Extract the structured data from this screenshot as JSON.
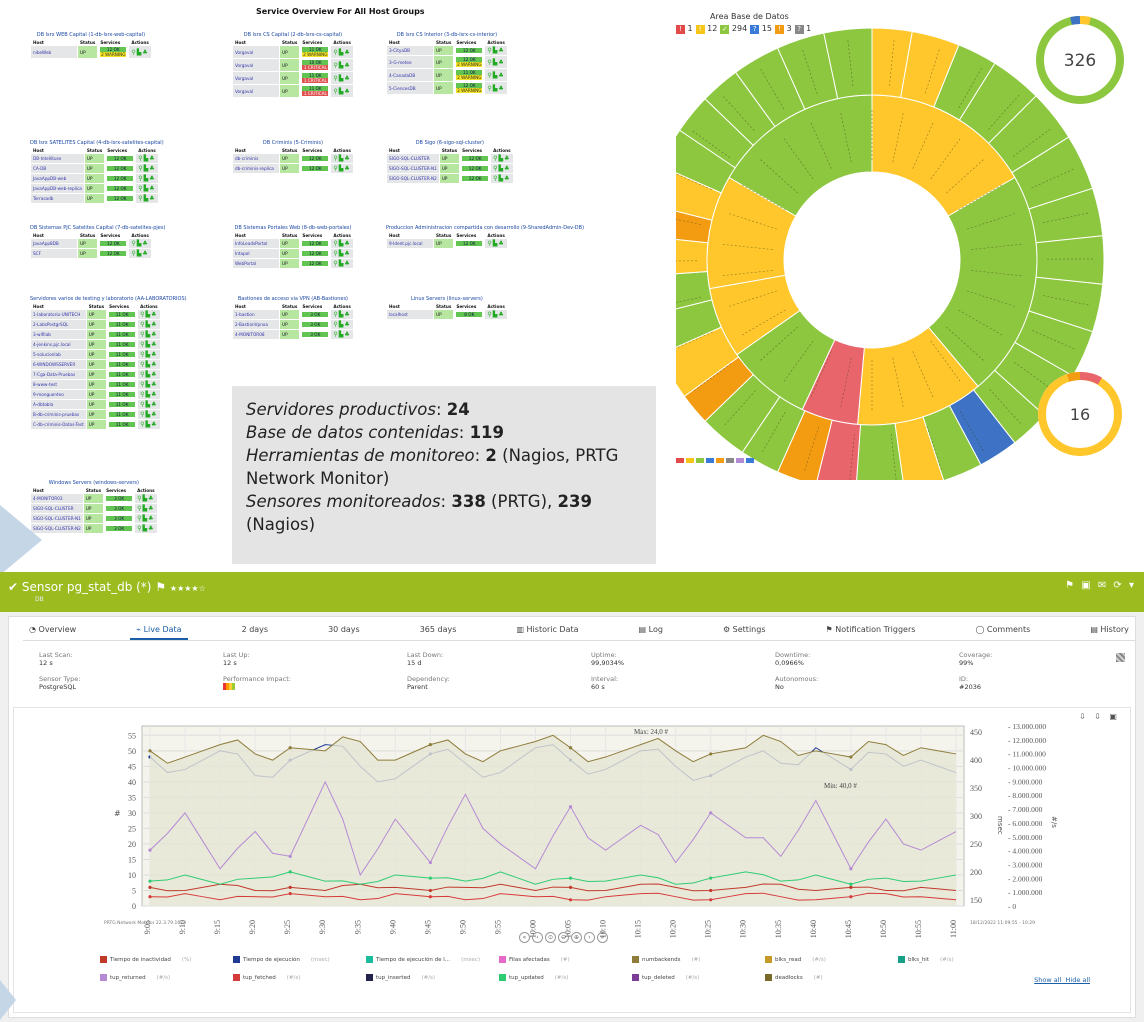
{
  "nagios": {
    "title": "Service Overview For All Host Groups",
    "col_host": "Host",
    "col_status": "Status",
    "col_services": "Services",
    "col_actions": "Actions",
    "groups": [
      {
        "id": "g1",
        "name": "DB lsrx WEB Capital (1-db-lsrx-web-capital)",
        "hosts": [
          {
            "h": "nibeWeb",
            "s": "UP",
            "sv": [
              [
                "ok",
                "12 OK"
              ],
              [
                "w",
                "2 WARNING"
              ]
            ]
          }
        ]
      },
      {
        "id": "g2",
        "name": "DB lsrx CS Capital (2-db-lsrx-cs-capital)",
        "hosts": [
          {
            "h": "Vorgaval",
            "s": "UP",
            "sv": [
              [
                "ok",
                "11 OK"
              ],
              [
                "w",
                "2 WARNING"
              ]
            ]
          },
          {
            "h": "Vorgaval",
            "s": "UP",
            "sv": [
              [
                "ok",
                "10 OK"
              ],
              [
                "c",
                "1 CRITICAL"
              ]
            ]
          },
          {
            "h": "Vorgaval",
            "s": "UP",
            "sv": [
              [
                "ok",
                "11 OK"
              ],
              [
                "c",
                "1 CRITICAL"
              ]
            ]
          },
          {
            "h": "Vorgaval",
            "s": "UP",
            "sv": [
              [
                "ok",
                "11 OK"
              ],
              [
                "c",
                "1 CRITICAL"
              ]
            ]
          }
        ]
      },
      {
        "id": "g3",
        "name": "DB lsrx CS Interior (3-db-lsrx-cs-interior)",
        "hosts": [
          {
            "h": "3-CityaDB",
            "s": "UP",
            "sv": [
              [
                "ok",
                "12 OK"
              ]
            ]
          },
          {
            "h": "3-G-meteo",
            "s": "UP",
            "sv": [
              [
                "ok",
                "12 OK"
              ],
              [
                "w",
                "2 WARNING"
              ]
            ]
          },
          {
            "h": "4-CanadaDB",
            "s": "UP",
            "sv": [
              [
                "ok",
                "11 OK"
              ],
              [
                "w",
                "2 WARNING"
              ]
            ]
          },
          {
            "h": "5-CiencesDB",
            "s": "UP",
            "sv": [
              [
                "ok",
                "12 OK"
              ],
              [
                "w",
                "2 WARNING"
              ]
            ]
          }
        ]
      },
      {
        "id": "g4",
        "name": "DB lsrx SATELITES Capital (4-db-lsrx-satelites-capital)",
        "hosts": [
          {
            "h": "DB-Intellituse",
            "s": "UP",
            "sv": [
              [
                "ok",
                "12 OK"
              ]
            ]
          },
          {
            "h": "CA-DB",
            "s": "UP",
            "sv": [
              [
                "ok",
                "12 OK"
              ]
            ]
          },
          {
            "h": "JavaAppDB-web",
            "s": "UP",
            "sv": [
              [
                "ok",
                "12 OK"
              ]
            ]
          },
          {
            "h": "JavaAppDB-web-replica",
            "s": "UP",
            "sv": [
              [
                "ok",
                "12 OK"
              ]
            ]
          },
          {
            "h": "Terrasadb",
            "s": "UP",
            "sv": [
              [
                "ok",
                "12 OK"
              ]
            ]
          }
        ]
      },
      {
        "id": "g5",
        "name": "DB Criminis (5-Criminis)",
        "hosts": [
          {
            "h": "db-criminis",
            "s": "UP",
            "sv": [
              [
                "ok",
                "12 OK"
              ]
            ]
          },
          {
            "h": "db-criminis-replica",
            "s": "UP",
            "sv": [
              [
                "ok",
                "12 OK"
              ]
            ]
          }
        ]
      },
      {
        "id": "g6",
        "name": "DB Sigo (6-sigo-sql-cluster)",
        "hosts": [
          {
            "h": "SIGO-SQL-CLUSTER",
            "s": "UP",
            "sv": [
              [
                "ok",
                "12 OK"
              ]
            ]
          },
          {
            "h": "SIGO-SQL-CLUSTER-N1",
            "s": "UP",
            "sv": [
              [
                "ok",
                "12 OK"
              ]
            ]
          },
          {
            "h": "SIGO-SQL-CLUSTER-N2",
            "s": "UP",
            "sv": [
              [
                "ok",
                "12 OK"
              ]
            ]
          }
        ]
      },
      {
        "id": "g7",
        "name": "DB Sistemas PJC Satelites Capital (7-db-satelites-pjes)",
        "hosts": [
          {
            "h": "JavaApp8DB",
            "s": "UP",
            "sv": [
              [
                "ok",
                "12 OK"
              ]
            ]
          },
          {
            "h": "SCF",
            "s": "UP",
            "sv": [
              [
                "ok",
                "12 OK"
              ]
            ]
          }
        ]
      },
      {
        "id": "g8",
        "name": "DB Sistemas Portales Web (8-db-web-portales)",
        "hosts": [
          {
            "h": "InfoLeadsPortal",
            "s": "UP",
            "sv": [
              [
                "ok",
                "12 OK"
              ]
            ]
          },
          {
            "h": "Intapol",
            "s": "UP",
            "sv": [
              [
                "ok",
                "12 OK"
              ]
            ]
          },
          {
            "h": "WebPortal",
            "s": "UP",
            "sv": [
              [
                "ok",
                "12 OK"
              ]
            ]
          }
        ]
      },
      {
        "id": "g9",
        "name": "Produccion Administracion compartida con desarrollo (9-SharedAdmin-Dev-DB)",
        "hosts": [
          {
            "h": "9-Ident.pjc.local",
            "s": "UP",
            "sv": [
              [
                "ok",
                "12 OK"
              ]
            ]
          }
        ]
      },
      {
        "id": "g10",
        "name": "Servidores varios de testing y laboratorio (AA-LABORATORIOS)",
        "hosts": [
          {
            "h": "1-laboratorio-UNITECH",
            "s": "UP",
            "sv": [
              [
                "ok",
                "11 OK"
              ]
            ]
          },
          {
            "h": "2-LabsPostgrSQL",
            "s": "UP",
            "sv": [
              [
                "ok",
                "11 OK"
              ]
            ]
          },
          {
            "h": "3-wifilab",
            "s": "UP",
            "sv": [
              [
                "ok",
                "11 OK"
              ]
            ]
          },
          {
            "h": "4-jenkins.pjc.local",
            "s": "UP",
            "sv": [
              [
                "ok",
                "11 OK"
              ]
            ]
          },
          {
            "h": "5-solucionlab",
            "s": "UP",
            "sv": [
              [
                "ok",
                "11 OK"
              ]
            ]
          },
          {
            "h": "6-WINDOWSSERVER",
            "s": "UP",
            "sv": [
              [
                "ok",
                "11 OK"
              ]
            ]
          },
          {
            "h": "7-Cga-Data-Pruebas",
            "s": "UP",
            "sv": [
              [
                "ok",
                "11 OK"
              ]
            ]
          },
          {
            "h": "8-www-test",
            "s": "UP",
            "sv": [
              [
                "ok",
                "11 OK"
              ]
            ]
          },
          {
            "h": "9-monguenteo",
            "s": "UP",
            "sv": [
              [
                "ok",
                "11 OK"
              ]
            ]
          },
          {
            "h": "A-dbtabla",
            "s": "UP",
            "sv": [
              [
                "ok",
                "11 OK"
              ]
            ]
          },
          {
            "h": "B-db-criminis-pruebas",
            "s": "UP",
            "sv": [
              [
                "ok",
                "11 OK"
              ]
            ]
          },
          {
            "h": "C-db-criminis-Datos-Test",
            "s": "UP",
            "sv": [
              [
                "ok",
                "11 OK"
              ]
            ]
          }
        ]
      },
      {
        "id": "g11",
        "name": "Bastiones de acceso via VPN (AB-Bastiones)",
        "hosts": [
          {
            "h": "1-bastion",
            "s": "UP",
            "sv": [
              [
                "ok",
                "3 OK"
              ]
            ]
          },
          {
            "h": "2-BastionVpnxa",
            "s": "UP",
            "sv": [
              [
                "ok",
                "3 OK"
              ]
            ]
          },
          {
            "h": "4-MONITOR08",
            "s": "UP",
            "sv": [
              [
                "ok",
                "3 OK"
              ]
            ]
          }
        ]
      },
      {
        "id": "g12",
        "name": "Linux Servers (linux-servers)",
        "hosts": [
          {
            "h": "localhost",
            "s": "UP",
            "sv": [
              [
                "ok",
                "8 OK"
              ]
            ]
          }
        ]
      },
      {
        "id": "g13",
        "name": "Windows Servers (windows-servers)",
        "hosts": [
          {
            "h": "4-MONITOR03",
            "s": "UP",
            "sv": [
              [
                "ok",
                "3 OK"
              ]
            ]
          },
          {
            "h": "SIGO-SQL-CLUSTER",
            "s": "UP",
            "sv": [
              [
                "ok",
                "3 OK"
              ]
            ]
          },
          {
            "h": "SIGO-SQL-CLUSTER-N1",
            "s": "UP",
            "sv": [
              [
                "ok",
                "3 OK"
              ]
            ]
          },
          {
            "h": "SIGO-SQL-CLUSTER-N2",
            "s": "UP",
            "sv": [
              [
                "ok",
                "3 OK"
              ]
            ]
          }
        ]
      }
    ]
  },
  "stats": {
    "l1_key": "Servidores productivos",
    "l1_val": "24",
    "l2_key": "Base de datos contenidas",
    "l2_val": "119",
    "l3_key": "Herramientas de monitoreo",
    "l3_val": "2",
    "l3_rest": " (Nagios, PRTG Network Monitor)",
    "l4_key": "Sensores monitoreados",
    "l4_val": "338",
    "l4_mid": " (PRTG), ",
    "l4_val2": "239",
    "l4_rest": " (Nagios)"
  },
  "sunburst": {
    "title": "Area Base de Datos",
    "counts": [
      {
        "label": "!",
        "value": "1",
        "color": "#e24a4a"
      },
      {
        "label": "!",
        "value": "12",
        "color": "#f5c518"
      },
      {
        "label": "✓",
        "value": "294",
        "color": "#8dc63f"
      },
      {
        "label": "?",
        "value": "15",
        "color": "#3a7ad8"
      },
      {
        "label": "!",
        "value": "3",
        "color": "#f39c12"
      },
      {
        "label": "?",
        "value": "1",
        "color": "#888888"
      }
    ],
    "donut_top": "326",
    "donut_bottom": "16",
    "colors": {
      "green": "#8dc63f",
      "yellow": "#ffc72c",
      "orange": "#f39c12",
      "red": "#e8666b",
      "blue": "#3d72c4",
      "grey": "#cfcfcf"
    }
  },
  "prtg": {
    "sensor_title": "Sensor pg_stat_db (*)",
    "stars": "★★★★☆",
    "sub": "DB",
    "tools": "⚑ ▣ ✉ ⟳ ▾",
    "tabs": [
      "Overview",
      "Live Data",
      "2 days",
      "30 days",
      "365 days",
      "Historic Data",
      "Log",
      "Settings",
      "Notification Triggers",
      "Comments",
      "History"
    ],
    "tab_icons": [
      "◔",
      "⌁",
      "",
      "",
      "",
      "▥",
      "▤",
      "⚙",
      "⚑",
      "◯",
      "▤"
    ],
    "info": [
      {
        "label": "Last Scan:",
        "value": "12 s"
      },
      {
        "label": "Last Up:",
        "value": "12 s"
      },
      {
        "label": "Last Down:",
        "value": "15 d"
      },
      {
        "label": "Uptime:",
        "value": "99,9034%"
      },
      {
        "label": "Downtime:",
        "value": "0,0966%"
      },
      {
        "label": "Coverage:",
        "value": "99%"
      },
      {
        "label": "Sensor Type:",
        "value": "PostgreSQL"
      },
      {
        "label": "Performance Impact:",
        "value": ""
      },
      {
        "label": "Dependency:",
        "value": "Parent"
      },
      {
        "label": "Interval:",
        "value": "60 s"
      },
      {
        "label": "Autonomous:",
        "value": "No"
      },
      {
        "label": "ID:",
        "value": "#2036"
      }
    ],
    "chart_tools": "⇩ ⇩ ▣",
    "chart_footer_left": "PRTG Network Monitor 22.3.79.1673",
    "chart_footer_right": "18/12/2022 11:09:55 - 10:29",
    "nav": [
      "«",
      "‹",
      "⊙",
      "⊖",
      "⊕",
      "›",
      "»"
    ],
    "show_all": "Show all",
    "hide_all": "Hide all",
    "legend": [
      {
        "name": "Tiempo de inactividad",
        "unit": "(%)",
        "color": "#c0392b"
      },
      {
        "name": "Tiempo de ejecución",
        "unit": "(msec)",
        "color": "#1f3a93"
      },
      {
        "name": "Tiempo de ejecución de l...",
        "unit": "(msec)",
        "color": "#1abc9c"
      },
      {
        "name": "Filas afectadas",
        "unit": "(#)",
        "color": "#e66ac7"
      },
      {
        "name": "numbackends",
        "unit": "(#)",
        "color": "#8e7c3a"
      },
      {
        "name": "blks_read",
        "unit": "(#/s)",
        "color": "#c59a2a"
      },
      {
        "name": "blks_hit",
        "unit": "(#/s)",
        "color": "#16a085"
      },
      {
        "name": "tup_returned",
        "unit": "(#/s)",
        "color": "#b58ad4"
      },
      {
        "name": "tup_fetched",
        "unit": "(#/s)",
        "color": "#d63b3b"
      },
      {
        "name": "tup_inserted",
        "unit": "(#/s)",
        "color": "#22224a"
      },
      {
        "name": "tup_updated",
        "unit": "(#/s)",
        "color": "#2ecc71"
      },
      {
        "name": "tup_deleted",
        "unit": "(#/s)",
        "color": "#7d3c98"
      },
      {
        "name": "deadlocks",
        "unit": "(#)",
        "color": "#7a6a2a"
      }
    ]
  },
  "chart_data": {
    "type": "line",
    "x": [
      "9:05",
      "9:10",
      "9:15",
      "9:20",
      "9:25",
      "9:30",
      "9:35",
      "9:40",
      "9:45",
      "9:50",
      "9:55",
      "10:00",
      "10:05",
      "10:10",
      "10:15",
      "10:20",
      "10:25",
      "10:30",
      "10:35",
      "10:40",
      "10:45",
      "10:50",
      "10:55",
      "11:00"
    ],
    "ylabel_left": "#",
    "ylabel_mid": "msec",
    "ylabel_right": "#/s",
    "left_ticks": [
      "55",
      "50",
      "45",
      "40",
      "35",
      "30",
      "25",
      "20",
      "15",
      "10",
      "5",
      "0"
    ],
    "mid_ticks": [
      "450",
      "400",
      "350",
      "300",
      "250",
      "200",
      "150"
    ],
    "right_ticks": [
      "13.000.000",
      "12.000.000",
      "11.000.000",
      "10.000.000",
      "9.000.000",
      "8.000.000",
      "7.000.000",
      "6.000.000",
      "5.000.000",
      "4.000.000",
      "3.000.000",
      "2.000.000",
      "1.000.000",
      "0"
    ],
    "annotations": {
      "max": "Max: 24,0 #",
      "min": "Min: 40,0 #"
    },
    "series": [
      {
        "name": "Tiempo de ejecución",
        "color": "#1f3a93",
        "values": [
          48,
          44,
          50,
          42,
          47,
          52,
          45,
          41,
          49,
          46,
          43,
          51,
          47,
          44,
          50,
          45,
          42,
          48,
          46,
          51,
          44,
          49,
          47,
          43
        ]
      },
      {
        "name": "numbackends",
        "color": "#8e7c3a",
        "values": [
          50,
          48,
          52,
          49,
          51,
          50,
          53,
          47,
          52,
          49,
          50,
          53,
          51,
          48,
          52,
          50,
          49,
          51,
          53,
          50,
          48,
          52,
          51,
          49
        ]
      },
      {
        "name": "tup_returned",
        "color": "#b58ad4",
        "values": [
          18,
          30,
          12,
          24,
          16,
          40,
          10,
          28,
          14,
          36,
          20,
          12,
          32,
          18,
          26,
          14,
          30,
          22,
          16,
          34,
          12,
          28,
          18,
          24
        ]
      },
      {
        "name": "Tiempo de inactividad",
        "color": "#c0392b",
        "values": [
          6,
          5,
          7,
          5,
          6,
          5,
          7,
          6,
          5,
          6,
          7,
          5,
          6,
          5,
          7,
          6,
          5,
          6,
          7,
          5,
          6,
          5,
          6,
          5
        ]
      },
      {
        "name": "tup_updated",
        "color": "#2ecc71",
        "values": [
          8,
          10,
          7,
          9,
          11,
          8,
          7,
          10,
          9,
          8,
          11,
          7,
          9,
          8,
          10,
          7,
          9,
          11,
          8,
          10,
          7,
          9,
          8,
          10
        ]
      },
      {
        "name": "tup_fetched",
        "color": "#d63b3b",
        "values": [
          3,
          4,
          2,
          3,
          4,
          3,
          2,
          4,
          3,
          2,
          4,
          3,
          2,
          3,
          4,
          3,
          2,
          4,
          3,
          2,
          3,
          4,
          3,
          2
        ]
      }
    ]
  }
}
